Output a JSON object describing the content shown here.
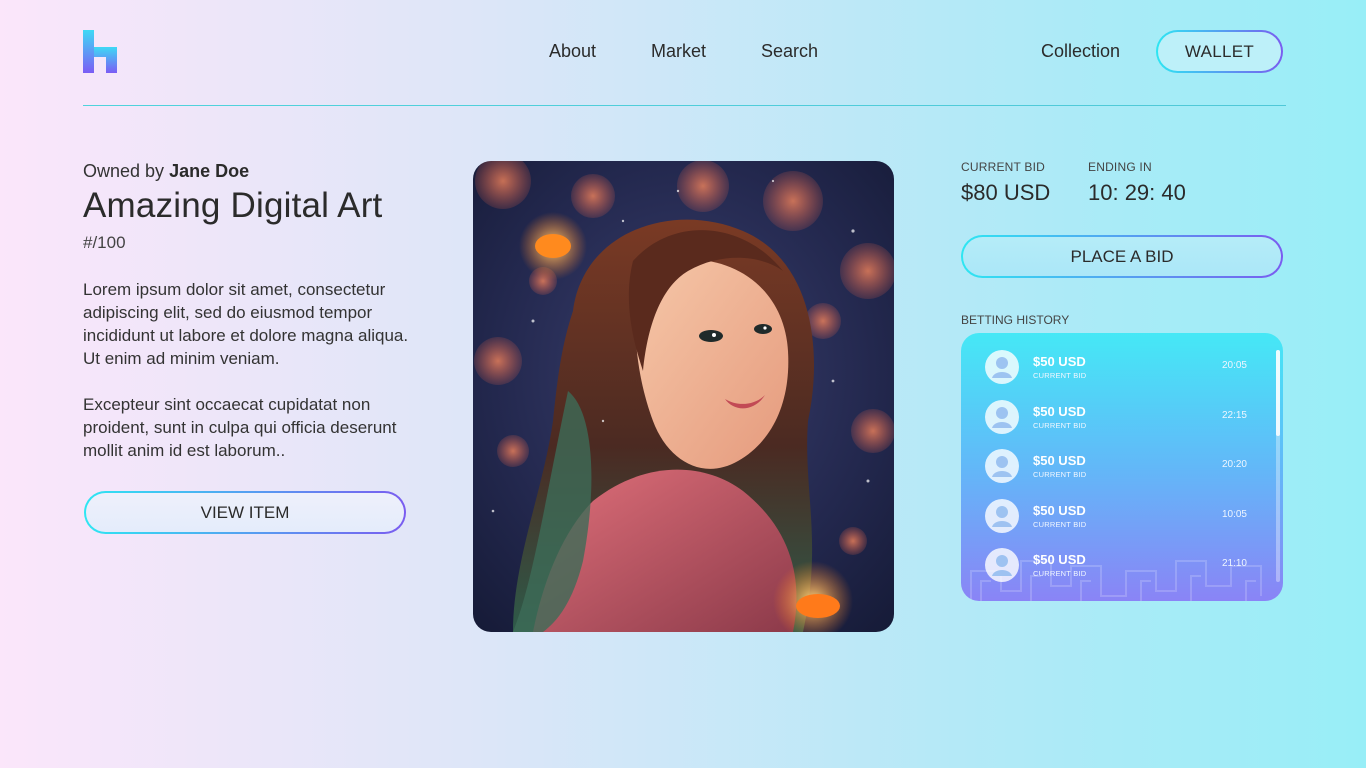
{
  "header": {
    "nav": [
      "About",
      "Market",
      "Search"
    ],
    "collection_label": "Collection",
    "wallet_label": "WALLET"
  },
  "item": {
    "owned_prefix": "Owned by",
    "owner": "Jane Doe",
    "title": "Amazing Digital Art",
    "edition": "#/100",
    "description_1": "Lorem ipsum dolor sit amet, consectetur adipiscing elit, sed do eiusmod tempor incididunt ut labore et dolore magna aliqua. Ut enim ad minim veniam.",
    "description_2": "Excepteur sint occaecat cupidatat non proident, sunt in culpa qui officia deserunt mollit anim id est laborum..",
    "view_button": "VIEW ITEM"
  },
  "bid": {
    "current_label": "CURRENT BID",
    "current_value": "$80 USD",
    "ending_label": "ENDING IN",
    "ending_value": "10: 29: 40",
    "place_bid_button": "PLACE A BID"
  },
  "history": {
    "label": "BETTING HISTORY",
    "rows": [
      {
        "amount": "$50 USD",
        "sub": "CURRENT BID",
        "time": "20:05"
      },
      {
        "amount": "$50 USD",
        "sub": "CURRENT BID",
        "time": "22:15"
      },
      {
        "amount": "$50 USD",
        "sub": "CURRENT BID",
        "time": "20:20"
      },
      {
        "amount": "$50 USD",
        "sub": "CURRENT BID",
        "time": "10:05"
      },
      {
        "amount": "$50 USD",
        "sub": "CURRENT BID",
        "time": "21:10"
      }
    ]
  },
  "colors": {
    "accent_start": "#2ee6f2",
    "accent_end": "#7a5cf0"
  },
  "icons": {
    "logo": "brand-logo",
    "avatar": "user-avatar-icon"
  }
}
